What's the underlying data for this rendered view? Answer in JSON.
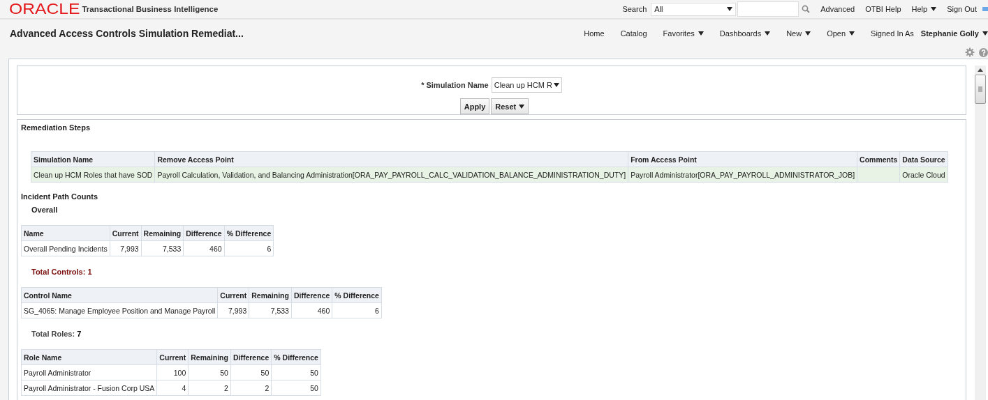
{
  "header": {
    "logo": "ORACLE",
    "product": "Transactional Business Intelligence",
    "search": {
      "label": "Search",
      "scope": "All"
    },
    "links": [
      {
        "label": "Advanced",
        "menu": false
      },
      {
        "label": "OTBI Help",
        "menu": false
      },
      {
        "label": "Help",
        "menu": true
      },
      {
        "label": "Sign Out",
        "menu": false
      }
    ]
  },
  "page_title": "Advanced Access Controls Simulation Remediat...",
  "nav": [
    {
      "label": "Home",
      "menu": false
    },
    {
      "label": "Catalog",
      "menu": false
    },
    {
      "label": "Favorites",
      "menu": true
    },
    {
      "label": "Dashboards",
      "menu": true
    },
    {
      "label": "New",
      "menu": true
    },
    {
      "label": "Open",
      "menu": true
    }
  ],
  "signed_in": {
    "label": "Signed In As",
    "user": "Stephanie Golly"
  },
  "prompt": {
    "required_mark": "*",
    "label": "Simulation Name",
    "value": "Clean up HCM R",
    "buttons": [
      {
        "label": "Apply",
        "menu": false
      },
      {
        "label": "Reset",
        "menu": true
      }
    ]
  },
  "section_title": "Remediation Steps",
  "steps_table": {
    "kind": "steps",
    "columns": [
      "Simulation Name",
      "Remove Access Point",
      "From Access Point",
      "Comments",
      "Data Source"
    ],
    "rows": [
      [
        "Clean up HCM Roles that have SOD",
        "Payroll Calculation, Validation, and Balancing Administration[ORA_PAY_PAYROLL_CALC_VALIDATION_BALANCE_ADMINISTRATION_DUTY]",
        "Payroll Administrator[ORA_PAY_PAYROLL_ADMINISTRATOR_JOB]",
        "",
        "Oracle Cloud"
      ]
    ]
  },
  "counts_title": "Incident Path Counts",
  "blocks": [
    {
      "heading": {
        "kind": "plain",
        "label": "Overall"
      },
      "table": {
        "kind": "counts",
        "columns": [
          "Name",
          "Current",
          "Remaining",
          "Difference",
          "% Difference"
        ],
        "rows": [
          [
            "Overall Pending Incidents",
            "7,993",
            "7,533",
            "460",
            "6"
          ]
        ]
      }
    },
    {
      "heading": {
        "kind": "alert",
        "label": "Total Controls:",
        "value": "1"
      },
      "table": {
        "kind": "counts",
        "columns": [
          "Control Name",
          "Current",
          "Remaining",
          "Difference",
          "% Difference"
        ],
        "rows": [
          [
            "SG_4065: Manage Employee Position and Manage Payroll",
            "7,993",
            "7,533",
            "460",
            "6"
          ]
        ]
      }
    },
    {
      "heading": {
        "kind": "total",
        "label": "Total Roles:",
        "value": "7"
      },
      "table": {
        "kind": "counts",
        "columns": [
          "Role Name",
          "Current",
          "Remaining",
          "Difference",
          "% Difference"
        ],
        "rows": [
          [
            "Payroll Administrator",
            "100",
            "50",
            "50",
            "50"
          ],
          [
            "Payroll Administrator - Fusion Corp USA",
            "4",
            "2",
            "2",
            "50"
          ]
        ]
      }
    }
  ]
}
